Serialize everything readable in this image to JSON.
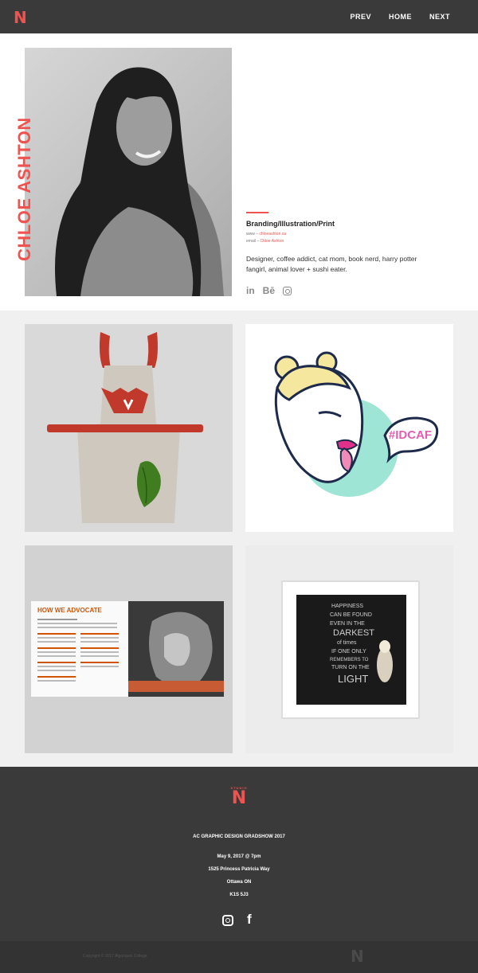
{
  "header": {
    "logo": "N",
    "nav": [
      "PREV",
      "HOME",
      "NEXT"
    ]
  },
  "profile": {
    "name": "CHLOE ASHTON",
    "discipline": "Branding/Illustration/Print",
    "www_label": "www –",
    "www_value": "chloeashton.ca",
    "email_label": "email –",
    "email_value": "Chloe Ashton",
    "bio": "Designer, coffee addict, cat mom, book nerd, harry potter fangirl, animal lover + sushi eater.",
    "socials": [
      "linkedin-icon",
      "behance-icon",
      "instagram-icon"
    ],
    "linkedin_text": "in",
    "behance_text": "Bē"
  },
  "gallery": {
    "apron_alt": "apron",
    "illustration_tag": "#IDCAF",
    "brochure_heading": "HOW WE ADVOCATE",
    "poster_text": [
      "HAPPINESS",
      "CAN BE FOUND",
      "EVEN IN THE",
      "DARKEST",
      "of times",
      "IF ONE ONLY",
      "REMEMBERS TO",
      "TURN ON THE",
      "LIGHT"
    ]
  },
  "footer": {
    "studio": "STUDIO",
    "logo": "N",
    "event": "AC GRAPHIC DESIGN GRADSHOW 2017",
    "date": "May 9, 2017 @ 7pm",
    "address1": "1525 Princess Patricia Way",
    "address2": "Ottawa ON",
    "postal": "K1S 5J3",
    "facebook_text": "f",
    "copyright": "Copyright © 2017 Algonquin College"
  },
  "colors": {
    "accent": "#ef5350",
    "dark": "#3a3a3a"
  }
}
